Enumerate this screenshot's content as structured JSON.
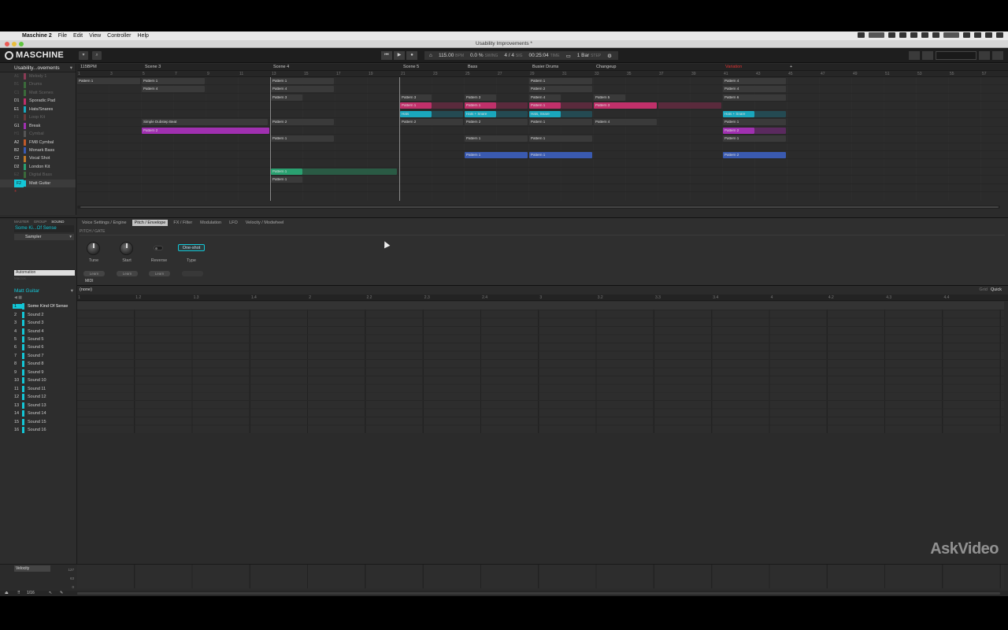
{
  "menubar": {
    "items": [
      "Maschine 2",
      "File",
      "Edit",
      "View",
      "Controller",
      "Help"
    ]
  },
  "window": {
    "title": "Usability Improvements *"
  },
  "header": {
    "logo": "MASCHINE",
    "tempo": "115.00",
    "tempo_unit": "BPM",
    "swing": "0.0 %",
    "swing_unit": "SWING",
    "signature": "4 / 4",
    "sig_unit": "SIG",
    "time": "00:25:04",
    "time_unit": "TIME",
    "length": "1 Bar",
    "length_unit": "STEP"
  },
  "arranger": {
    "project": "Usability...ovements",
    "scenes": [
      "115BPM",
      "Scene 3",
      "Scene 4",
      "Scene 5",
      "Bass",
      "Busier Drums",
      "Changeup",
      "Variation"
    ],
    "bar_numbers": [
      "1",
      "3",
      "5",
      "7",
      "9",
      "11",
      "13",
      "15",
      "17",
      "19",
      "21",
      "23",
      "25",
      "27",
      "29",
      "31",
      "33",
      "35",
      "37",
      "39",
      "41",
      "43",
      "45",
      "47",
      "49",
      "51",
      "53",
      "55",
      "57"
    ],
    "groups": [
      {
        "slot": "A1",
        "name": "Melody 1",
        "color": "#8a3b55",
        "dim": true
      },
      {
        "slot": "B1",
        "name": "Drums",
        "color": "#3a6a3a",
        "dim": true
      },
      {
        "slot": "C1",
        "name": "Matt Scenes",
        "color": "#3a6a3a",
        "dim": true
      },
      {
        "slot": "D1",
        "name": "Sporadic Pad",
        "color": "#c0306a",
        "dim": false
      },
      {
        "slot": "E1",
        "name": "Hats/Snares",
        "color": "#1aa7bd",
        "dim": false
      },
      {
        "slot": "F1",
        "name": "Loop Kit",
        "color": "#6a3a3a",
        "dim": true
      },
      {
        "slot": "G1",
        "name": "Break",
        "color": "#a030b0",
        "dim": false
      },
      {
        "slot": "H1",
        "name": "Cymbal",
        "color": "#555",
        "dim": true
      },
      {
        "slot": "A2",
        "name": "FM8 Cymbal",
        "color": "#c05a2a",
        "dim": false
      },
      {
        "slot": "B2",
        "name": "Monark Bass",
        "color": "#3a5ab0",
        "dim": false
      },
      {
        "slot": "C2",
        "name": "Vocal Shot",
        "color": "#c07a2a",
        "dim": false
      },
      {
        "slot": "D2",
        "name": "London Kit",
        "color": "#2aa070",
        "dim": false
      },
      {
        "slot": "E2",
        "name": "Digital Bass",
        "color": "#3a6a3a",
        "dim": true
      },
      {
        "slot": "F2",
        "name": "Matt Guitar",
        "color": "#13c6d6",
        "dim": false,
        "selected": true
      }
    ],
    "clips": {
      "pattern1": "Pattern 1",
      "pattern2": "Pattern 2",
      "pattern3": "Pattern 3",
      "pattern4": "Pattern 4",
      "pattern5": "Pattern 5",
      "pattern6": "Pattern 6",
      "hats": "Hats",
      "hats_snare": "Hats + Snare",
      "hats_snare2": "Hats, Snare",
      "simple": "Simple Dubstep Beat"
    }
  },
  "plugin": {
    "modes": [
      "MASTER",
      "GROUP",
      "SOUND"
    ],
    "sound_name": "Some Ki...Of Sense",
    "plugin_name": "Sampler",
    "tabs": [
      "Voice Settings / Engine",
      "Pitch / Envelope",
      "FX / Filter",
      "Modulation",
      "LFO",
      "Velocity / Modwheel"
    ],
    "active_tab": "Pitch / Envelope",
    "page_label": "PITCH / GATE",
    "knobs": [
      {
        "label": "Tune"
      },
      {
        "label": "Start"
      }
    ],
    "reverse_label": "Reverse",
    "type_value": "One-shot",
    "type_label": "Type",
    "automation_label": "Automation",
    "macros_label": "Macros",
    "learn": [
      "Learn",
      "Learn",
      "Learn"
    ],
    "midi_label": "MIDI"
  },
  "pattern": {
    "group_name": "Matt Guitar",
    "pattern_name": "(none)",
    "grid_label": "Grid",
    "grid_value": "Quick",
    "ruler": [
      "1",
      "1.2",
      "1.3",
      "1.4",
      "2",
      "2.2",
      "2.3",
      "2.4",
      "3",
      "3.2",
      "3.3",
      "3.4",
      "4",
      "4.2",
      "4.3",
      "4.4"
    ],
    "sounds": [
      "Some Kind Of Sense",
      "Sound 2",
      "Sound 3",
      "Sound 4",
      "Sound 5",
      "Sound 6",
      "Sound 7",
      "Sound 8",
      "Sound 9",
      "Sound 10",
      "Sound 11",
      "Sound 12",
      "Sound 13",
      "Sound 14",
      "Sound 15",
      "Sound 16"
    ],
    "velocity_label": "Velocity",
    "velocity_max": "127",
    "velocity_mid": "63",
    "velocity_min": "0",
    "step": "1/16"
  },
  "watermark": "AskVideo"
}
